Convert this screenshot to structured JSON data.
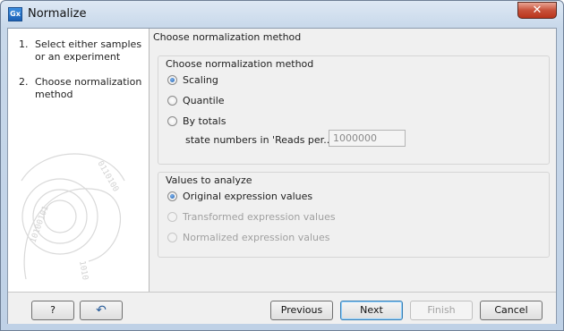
{
  "window": {
    "title": "Normalize",
    "app_icon_text": "Gx",
    "close_glyph": "✕"
  },
  "steps": [
    {
      "number": "1.",
      "label": "Select either samples or an experiment"
    },
    {
      "number": "2.",
      "label": "Choose normalization method"
    }
  ],
  "main": {
    "header": "Choose normalization method",
    "method_group": {
      "title": "Choose normalization method",
      "options": [
        {
          "label": "Scaling",
          "checked": true,
          "enabled": true
        },
        {
          "label": "Quantile",
          "checked": false,
          "enabled": true
        },
        {
          "label": "By totals",
          "checked": false,
          "enabled": true
        }
      ],
      "reads_label": "state numbers in 'Reads per...':",
      "reads_value": "1000000"
    },
    "values_group": {
      "title": "Values to analyze",
      "options": [
        {
          "label": "Original expression values",
          "checked": true,
          "enabled": true
        },
        {
          "label": "Transformed expression values",
          "checked": false,
          "enabled": false
        },
        {
          "label": "Normalized expression values",
          "checked": false,
          "enabled": false
        }
      ]
    }
  },
  "footer": {
    "help_label": "?",
    "reset_icon": "↶",
    "previous_label": "Previous",
    "next_label": "Next",
    "finish_label": "Finish",
    "cancel_label": "Cancel"
  }
}
